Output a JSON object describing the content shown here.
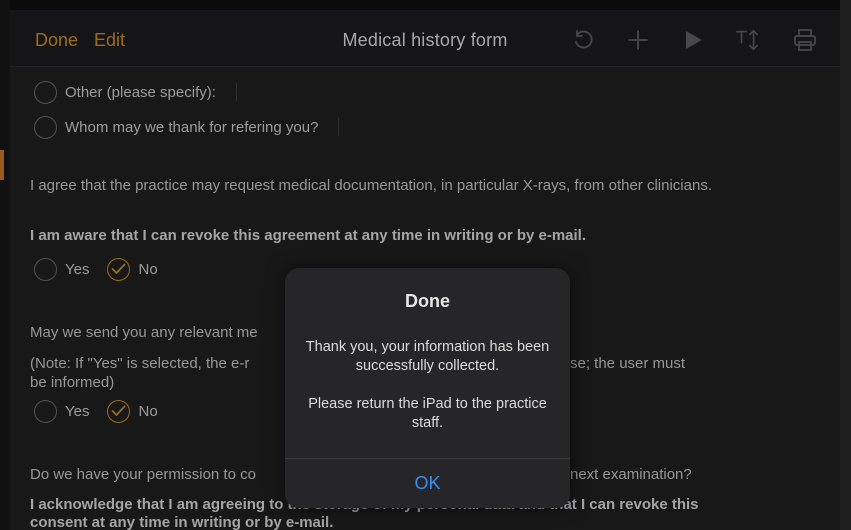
{
  "toolbar": {
    "done_label": "Done",
    "edit_label": "Edit",
    "title": "Medical history form",
    "icons": [
      "undo-icon",
      "add-icon",
      "play-icon",
      "text-size-icon",
      "print-icon"
    ]
  },
  "form": {
    "referral_options": [
      {
        "label": "Other (please specify):",
        "checked": false
      },
      {
        "label": "Whom may we thank for refering you?",
        "checked": false
      }
    ],
    "documentation": {
      "statement": "I agree that the practice may request medical documentation, in particular X-rays, from other clinicians.",
      "revoke_note": "I am aware that I can revoke this agreement at any time in writing or by e-mail.",
      "yes_label": "Yes",
      "no_label": "No",
      "selected": "No"
    },
    "email_consent": {
      "question": "May we send you any relevant me",
      "note_line1_left": "(Note: If \"Yes\" is selected, the e-r",
      "note_line1_right": "se; the user must",
      "note_line2": "be informed)",
      "yes_label": "Yes",
      "no_label": "No",
      "selected": "No"
    },
    "storage_consent": {
      "question_left": "Do we have your permission to co",
      "question_right": "next examination?",
      "ack_line1": "I acknowledge that I am agreeing to the storage of my personal data and that I can revoke this",
      "ack_line2": "consent at any time in writing or by e-mail."
    }
  },
  "dialog": {
    "title": "Done",
    "message1": "Thank you, your information has been successfully collected.",
    "message2": "Please return the iPad to the practice staff.",
    "ok_label": "OK"
  },
  "colors": {
    "accent": "#c98a2c",
    "ok_blue": "#3d8cf0",
    "background": "#1f1f20"
  }
}
